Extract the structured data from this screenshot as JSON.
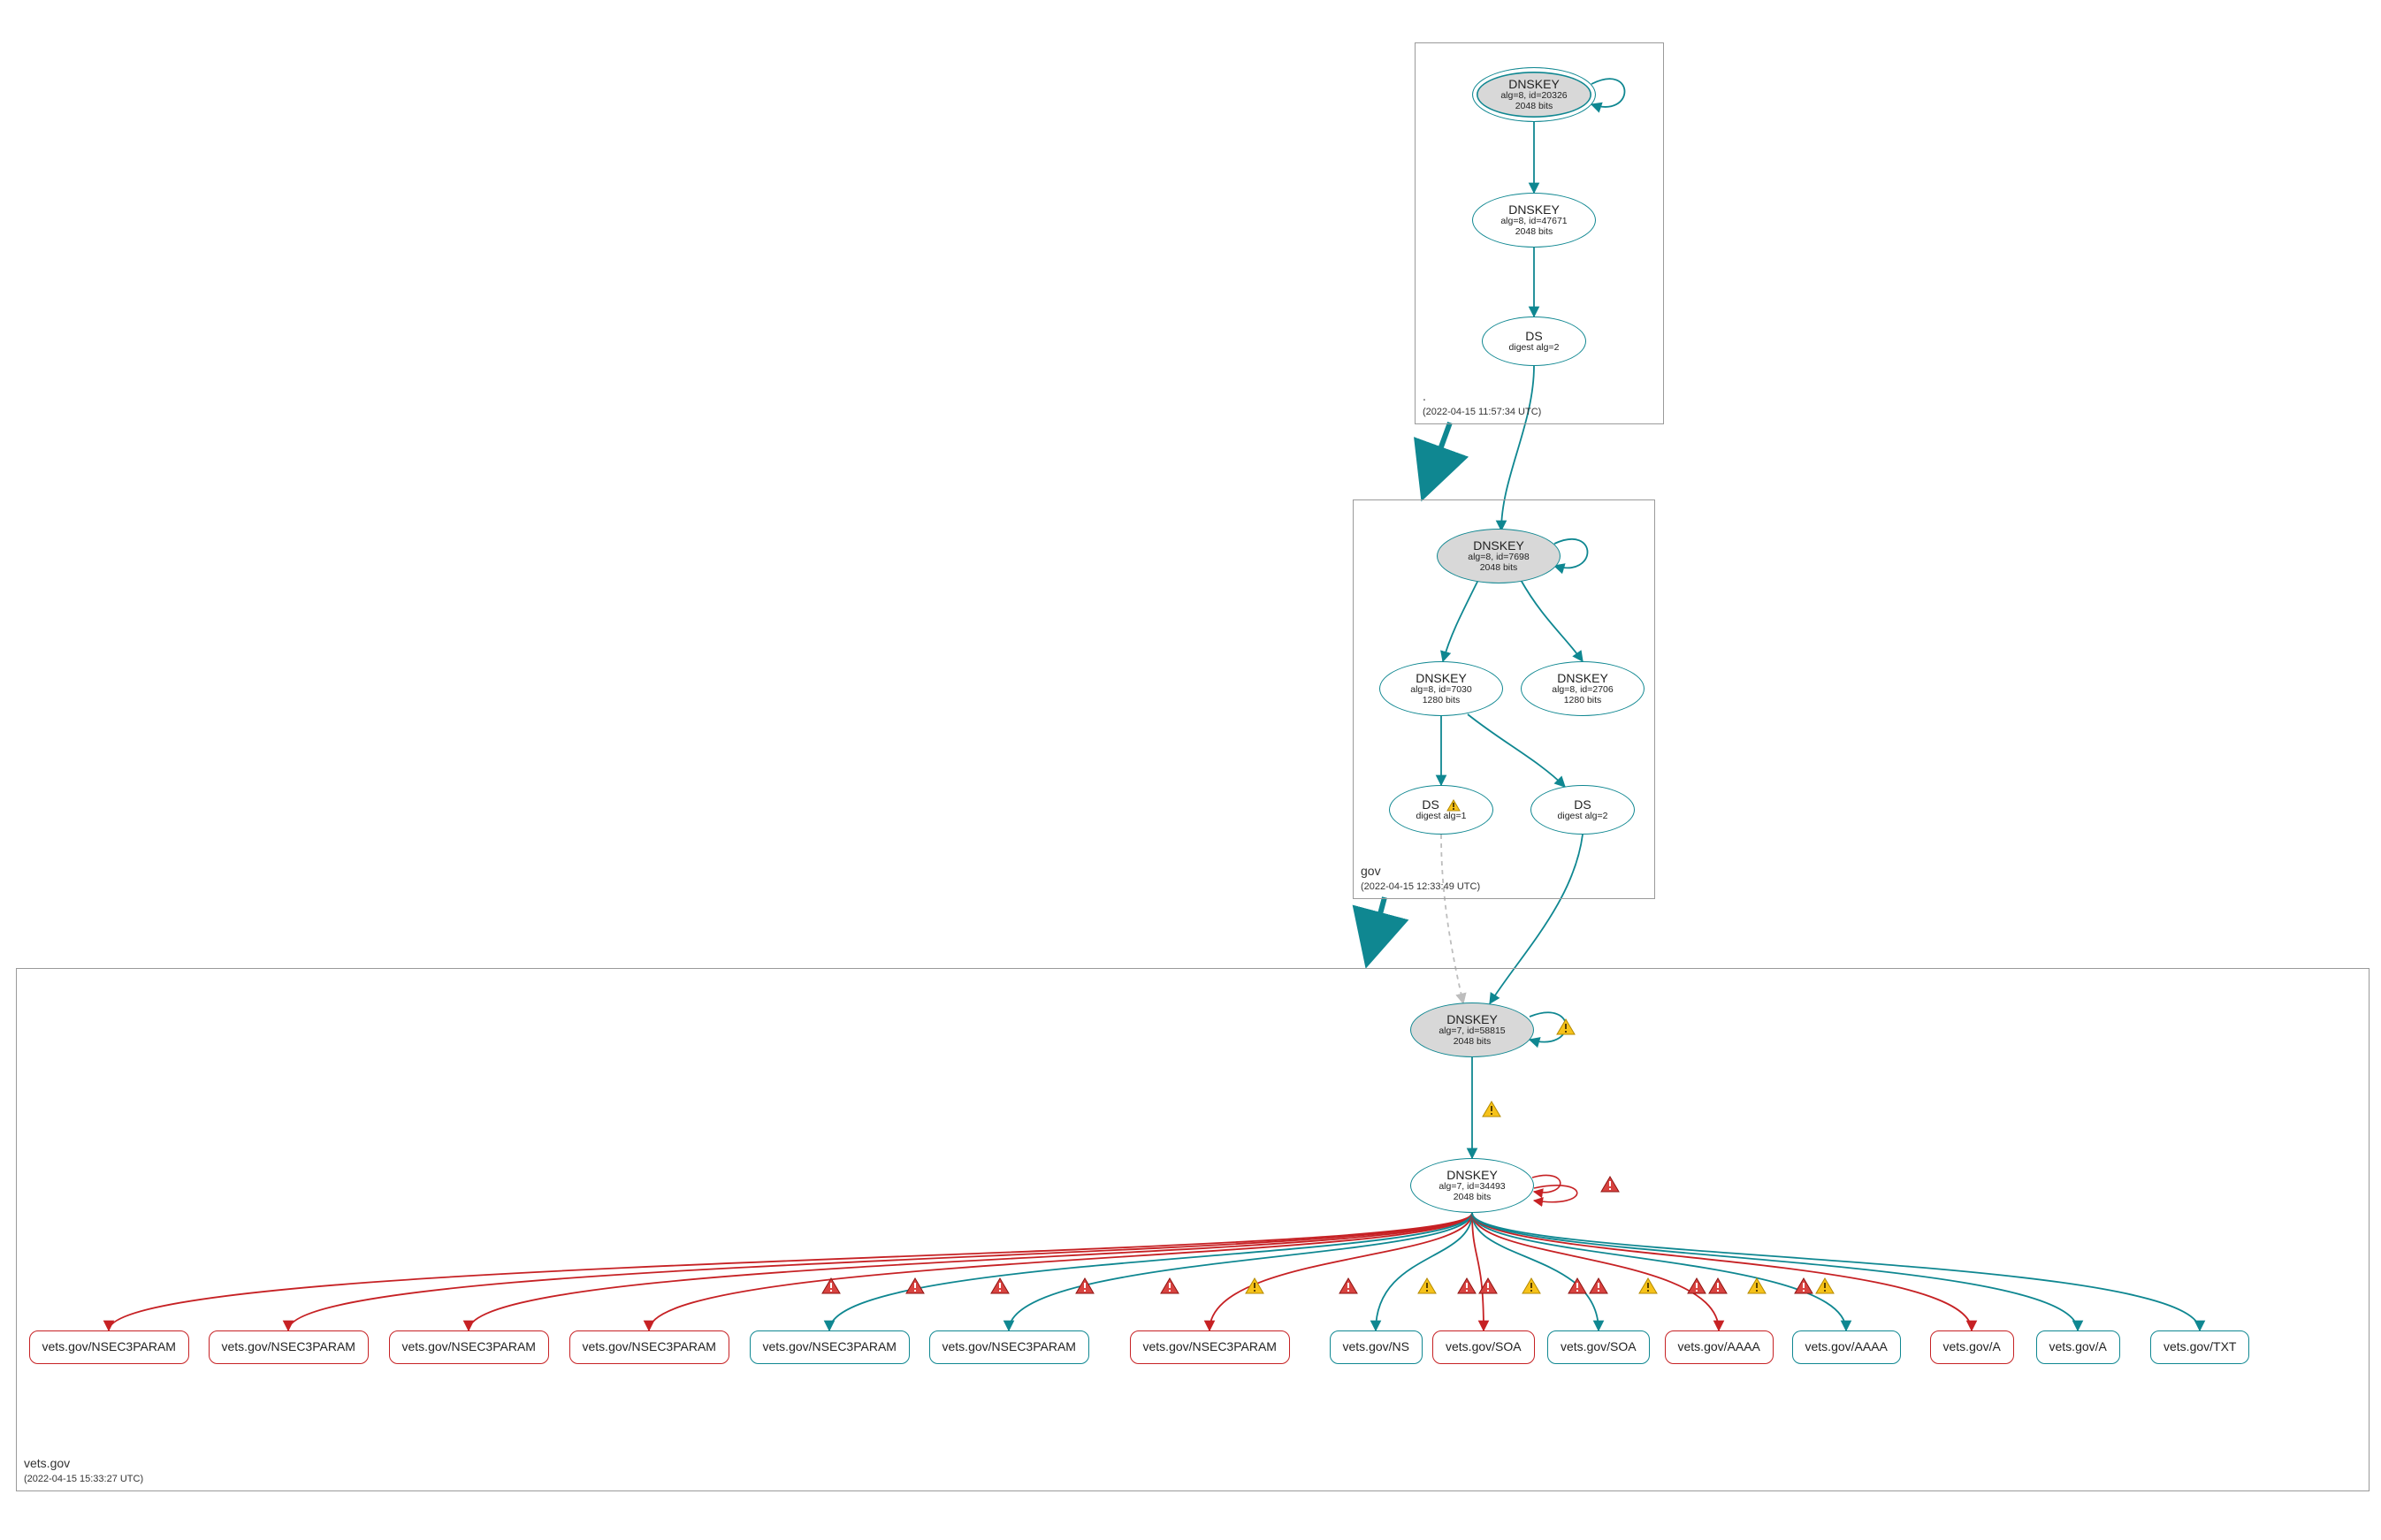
{
  "colors": {
    "teal": "#0f8791",
    "red": "#c62124",
    "grey": "#bdbdbd",
    "yellow": "#f6c21a",
    "redfill": "#d84340"
  },
  "zones": {
    "root": {
      "label": ".",
      "timestamp": "(2022-04-15 11:57:34 UTC)"
    },
    "gov": {
      "label": "gov",
      "timestamp": "(2022-04-15 12:33:49 UTC)"
    },
    "vets": {
      "label": "vets.gov",
      "timestamp": "(2022-04-15 15:33:27 UTC)"
    }
  },
  "nodes": {
    "root_ksk": {
      "title": "DNSKEY",
      "detail1": "alg=8, id=20326",
      "detail2": "2048 bits"
    },
    "root_zsk": {
      "title": "DNSKEY",
      "detail1": "alg=8, id=47671",
      "detail2": "2048 bits"
    },
    "root_ds": {
      "title": "DS",
      "detail1": "digest alg=2"
    },
    "gov_ksk": {
      "title": "DNSKEY",
      "detail1": "alg=8, id=7698",
      "detail2": "2048 bits"
    },
    "gov_zsk1": {
      "title": "DNSKEY",
      "detail1": "alg=8, id=7030",
      "detail2": "1280 bits"
    },
    "gov_zsk2": {
      "title": "DNSKEY",
      "detail1": "alg=8, id=2706",
      "detail2": "1280 bits"
    },
    "gov_ds1": {
      "title": "DS",
      "detail1": "digest alg=1",
      "warn": true
    },
    "gov_ds2": {
      "title": "DS",
      "detail1": "digest alg=2"
    },
    "vets_ksk": {
      "title": "DNSKEY",
      "detail1": "alg=7, id=58815",
      "detail2": "2048 bits"
    },
    "vets_zsk": {
      "title": "DNSKEY",
      "detail1": "alg=7, id=34493",
      "detail2": "2048 bits"
    }
  },
  "rr": [
    {
      "label": "vets.gov/NSEC3PARAM",
      "color": "red"
    },
    {
      "label": "vets.gov/NSEC3PARAM",
      "color": "red"
    },
    {
      "label": "vets.gov/NSEC3PARAM",
      "color": "red"
    },
    {
      "label": "vets.gov/NSEC3PARAM",
      "color": "red"
    },
    {
      "label": "vets.gov/NSEC3PARAM",
      "color": "teal"
    },
    {
      "label": "vets.gov/NSEC3PARAM",
      "color": "teal"
    },
    {
      "label": "vets.gov/NSEC3PARAM",
      "color": "red"
    },
    {
      "label": "vets.gov/NS",
      "color": "teal"
    },
    {
      "label": "vets.gov/SOA",
      "color": "red"
    },
    {
      "label": "vets.gov/SOA",
      "color": "teal"
    },
    {
      "label": "vets.gov/AAAA",
      "color": "red"
    },
    {
      "label": "vets.gov/AAAA",
      "color": "teal"
    },
    {
      "label": "vets.gov/A",
      "color": "red"
    },
    {
      "label": "vets.gov/A",
      "color": "teal"
    },
    {
      "label": "vets.gov/TXT",
      "color": "teal"
    }
  ],
  "rr_edge_warn": [
    {
      "type": "red"
    },
    {
      "type": "red"
    },
    {
      "type": "red"
    },
    {
      "type": "red"
    },
    {
      "type": "red"
    },
    {
      "type": "yellow"
    },
    {
      "type": "red"
    },
    {
      "type": "yellow"
    },
    {
      "type": "redred"
    },
    {
      "type": "yellow"
    },
    {
      "type": "redred"
    },
    {
      "type": "yellow"
    },
    {
      "type": "redred"
    },
    {
      "type": "yellow"
    },
    {
      "type": "redyellow"
    }
  ]
}
